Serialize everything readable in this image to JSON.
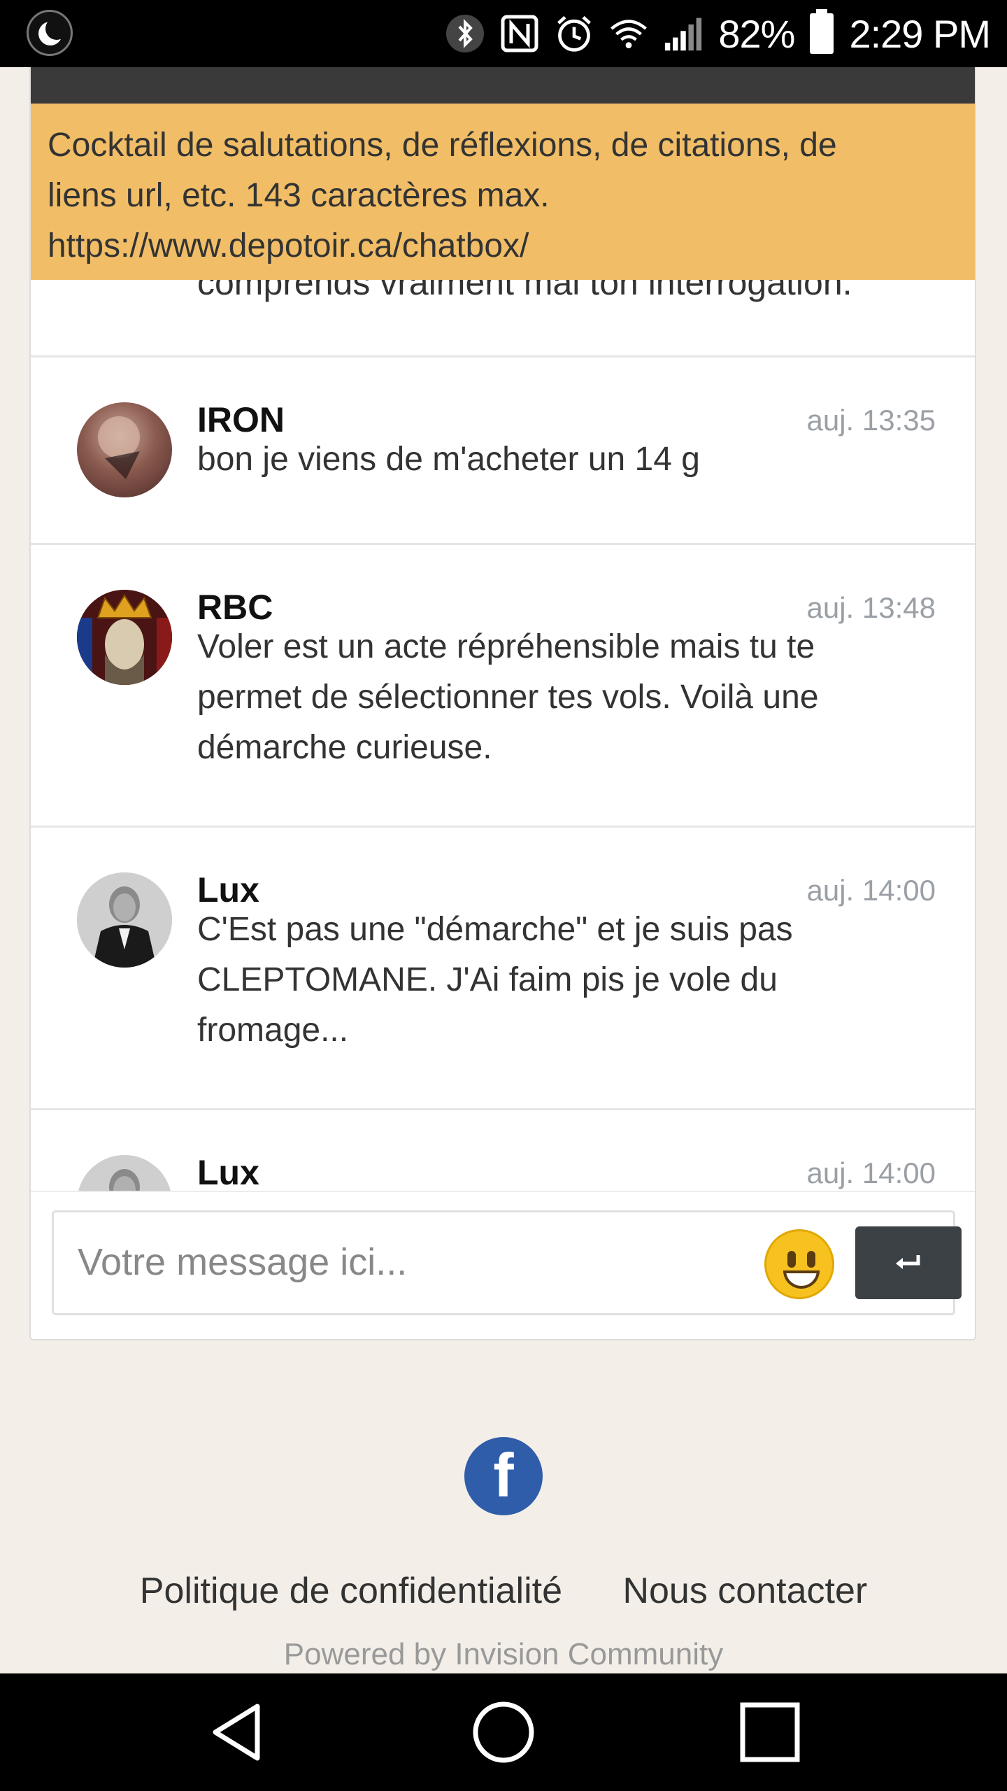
{
  "status_bar": {
    "battery": "82%",
    "time": "2:29 PM",
    "icons": [
      "moon-icon",
      "bluetooth-icon",
      "nfc-icon",
      "alarm-icon",
      "wifi-icon",
      "signal-icon",
      "battery-icon"
    ]
  },
  "chatbox": {
    "banner": {
      "line1": "Cocktail de salutations, de réflexions, de citations, de",
      "line2": "liens url, etc. 143 caractères max.",
      "line3": "https://www.depotoir.ca/chatbox/"
    },
    "previous_fragment": "comprends vraiment mal ton interrogation.",
    "messages": [
      {
        "author": "IRON",
        "time": "auj. 13:35",
        "lines": [
          "bon je viens de m'acheter un 14 g"
        ]
      },
      {
        "author": "RBC",
        "time": "auj. 13:48",
        "lines": [
          "Voler est un acte répréhensible mais tu te",
          "permet de sélectionner tes vols. Voilà une",
          "démarche curieuse."
        ]
      },
      {
        "author": "Lux",
        "time": "auj. 14:00",
        "lines": [
          "C'Est pas une \"démarche\" et je suis pas",
          "CLEPTOMANE. J'Ai faim pis je vole du",
          "fromage..."
        ]
      },
      {
        "author": "Lux",
        "time": "auj. 14:00",
        "lines": []
      }
    ],
    "composer": {
      "placeholder": "Votre message ici...",
      "send_icon": "enter-icon",
      "emoji_icon": "smiley-icon"
    }
  },
  "footer": {
    "social_icon": "facebook-icon",
    "facebook_glyph": "f",
    "links": [
      "Politique de confidentialité",
      "Nous contacter"
    ],
    "powered_by": "Powered by Invision Community"
  },
  "colors": {
    "banner_bg": "#f1be67",
    "page_bg": "#f3efe8",
    "send_button": "#3c4146",
    "facebook": "#2f5da9"
  }
}
